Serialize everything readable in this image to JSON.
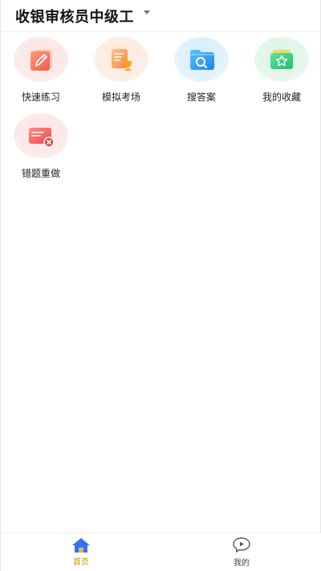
{
  "header": {
    "title": "收银审核员中级工"
  },
  "tiles": [
    {
      "label": "快速练习",
      "icon": "pencil-icon"
    },
    {
      "label": "模拟考场",
      "icon": "exam-icon"
    },
    {
      "label": "搜答案",
      "icon": "search-icon"
    },
    {
      "label": "我的收藏",
      "icon": "star-folder-icon"
    },
    {
      "label": "错题重做",
      "icon": "wrong-card-icon"
    }
  ],
  "tabbar": {
    "items": [
      {
        "label": "首页",
        "icon": "home-icon",
        "active": true
      },
      {
        "label": "我的",
        "icon": "chat-bubble-icon",
        "active": false
      }
    ]
  },
  "colors": {
    "active_tab": "#b89a00",
    "home_icon": "#3b6ff0"
  }
}
